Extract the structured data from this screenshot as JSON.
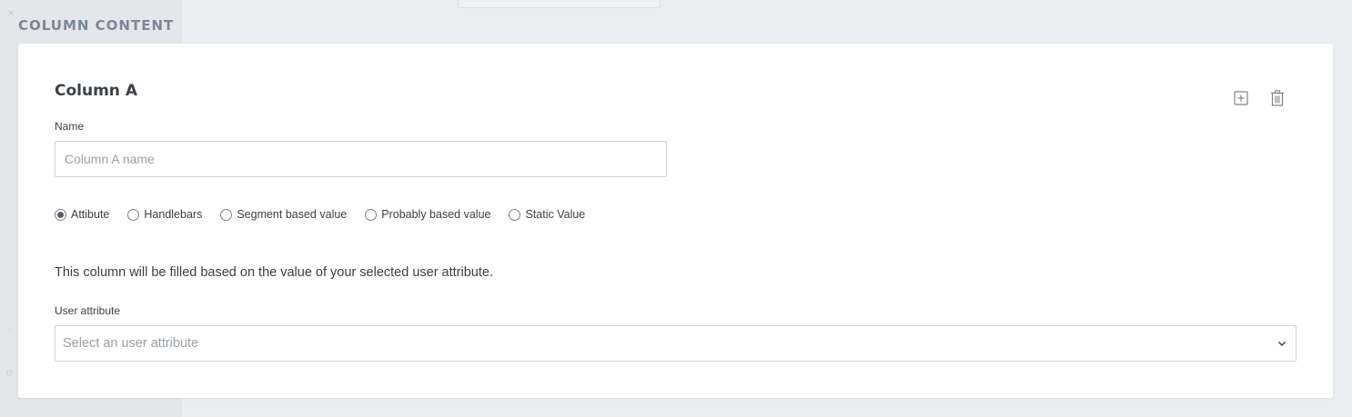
{
  "section": {
    "title": "COLUMN CONTENT"
  },
  "card": {
    "title": "Column A",
    "name_field": {
      "label": "Name",
      "placeholder": "Column A name",
      "value": ""
    },
    "content_type": {
      "selected": "Attibute",
      "options": [
        "Attibute",
        "Handlebars",
        "Segment based value",
        "Probably based value",
        "Static Value"
      ]
    },
    "description": "This column will be filled based on the value of your selected user attribute.",
    "user_attribute": {
      "label": "User attribute",
      "placeholder": "Select an user attribute"
    },
    "actions": {
      "add_icon": "plus-square-icon",
      "delete_icon": "trash-icon"
    }
  }
}
